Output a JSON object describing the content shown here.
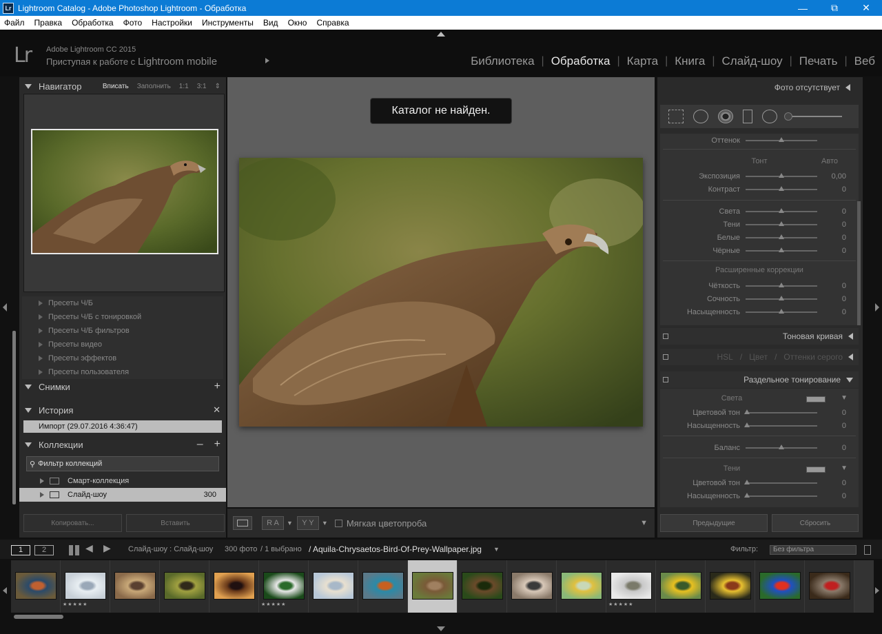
{
  "window": {
    "title": "Lightroom Catalog - Adobe Photoshop Lightroom - Обработка",
    "icon": "Lr"
  },
  "menu": [
    "Файл",
    "Правка",
    "Обработка",
    "Фото",
    "Настройки",
    "Инструменты",
    "Вид",
    "Окно",
    "Справка"
  ],
  "header": {
    "logo": "Lr",
    "app_name": "Adobe Lightroom CC 2015",
    "mobile_prefix": "Приступая к работе с",
    "mobile_brand": "Lightroom mobile"
  },
  "modules": [
    {
      "label": "Библиотека",
      "active": false
    },
    {
      "label": "Обработка",
      "active": true
    },
    {
      "label": "Карта",
      "active": false
    },
    {
      "label": "Книга",
      "active": false
    },
    {
      "label": "Слайд-шоу",
      "active": false
    },
    {
      "label": "Печать",
      "active": false
    },
    {
      "label": "Веб",
      "active": false
    }
  ],
  "navigator": {
    "title": "Навигатор",
    "zoom": [
      "Вписать",
      "Заполнить",
      "1:1",
      "3:1"
    ],
    "zoom_selected": "Вписать"
  },
  "presets": [
    "Пресеты Ч/Б",
    "Пресеты Ч/Б с тонировкой",
    "Пресеты Ч/Б фильтров",
    "Пресеты видео",
    "Пресеты эффектов",
    "Пресеты пользователя"
  ],
  "snapshots": {
    "title": "Снимки"
  },
  "history": {
    "title": "История",
    "item": "Импорт (29.07.2016 4:36:47)"
  },
  "collections": {
    "title": "Коллекции",
    "filter_placeholder": "Фильтр коллекций",
    "items": [
      {
        "label": "Смарт-коллекция",
        "count": ""
      },
      {
        "label": "Слайд-шоу",
        "count": "300"
      }
    ]
  },
  "left_buttons": {
    "copy": "Копировать...",
    "paste": "Вставить"
  },
  "toast": "Каталог не найден.",
  "toolbar": {
    "soft_proof": "Мягкая цветопроба",
    "ra": "R A",
    "yy": "Y Y"
  },
  "right_panel": {
    "no_photo": "Фото отсутствует",
    "basic": {
      "tint_label": "Оттенок",
      "tone_title": "Тонт",
      "auto": "Авто",
      "exposure": {
        "label": "Экспозиция",
        "value": "0,00"
      },
      "contrast": {
        "label": "Контраст",
        "value": "0"
      },
      "highlights": {
        "label": "Света",
        "value": "0"
      },
      "shadows": {
        "label": "Тени",
        "value": "0"
      },
      "whites": {
        "label": "Белые",
        "value": "0"
      },
      "blacks": {
        "label": "Чёрные",
        "value": "0"
      },
      "presence_title": "Расширенные коррекции",
      "clarity": {
        "label": "Чёткость",
        "value": "0"
      },
      "vibrance": {
        "label": "Сочность",
        "value": "0"
      },
      "saturation": {
        "label": "Насыщенность",
        "value": "0"
      }
    },
    "tone_curve": "Тоновая кривая",
    "hsl": [
      "HSL",
      "Цвет",
      "Оттенки серого"
    ],
    "split_toning": {
      "title": "Раздельное тонирование",
      "highlights_title": "Света",
      "hue": {
        "label": "Цветовой тон",
        "value": "0"
      },
      "saturation": {
        "label": "Насыщенность",
        "value": "0"
      },
      "balance": {
        "label": "Баланс",
        "value": "0"
      },
      "shadows_title": "Тени",
      "hue2": {
        "label": "Цветовой тон",
        "value": "0"
      },
      "saturation2": {
        "label": "Насыщенность",
        "value": "0"
      }
    },
    "buttons": {
      "previous": "Предыдущие",
      "reset": "Сбросить"
    }
  },
  "filmstrip_bar": {
    "page1": "1",
    "page2": "2",
    "source": "Слайд-шоу : Слайд-шоу",
    "count": "300 фото",
    "selected": "/ 1 выбрано",
    "filename": "/ Aquila-Chrysaetos-Bird-Of-Prey-Wallpaper.jpg",
    "filter_label": "Фильтр:",
    "filter_value": "Без фильтра"
  },
  "filmstrip": [
    {
      "name": "mandarin-duck",
      "colors": [
        "#6a5a3a",
        "#2a4a6a",
        "#c06030"
      ],
      "stars": ""
    },
    {
      "name": "white-peacock",
      "colors": [
        "#c8d0d8",
        "#e8eef2",
        "#9aa8b8"
      ],
      "stars": "★★★★★"
    },
    {
      "name": "eagle-head",
      "colors": [
        "#8a6a4a",
        "#c8a878",
        "#5a4030"
      ],
      "stars": ""
    },
    {
      "name": "crowned-crane",
      "colors": [
        "#5a6a2a",
        "#a0a040",
        "#302a1a"
      ],
      "stars": ""
    },
    {
      "name": "bird-branch",
      "colors": [
        "#e0a050",
        "#6a3a1a",
        "#201010"
      ],
      "stars": ""
    },
    {
      "name": "swan",
      "colors": [
        "#1a4a1a",
        "#e8e8e8",
        "#2a6a2a"
      ],
      "stars": "★★★★★"
    },
    {
      "name": "pelican",
      "colors": [
        "#b8c8d8",
        "#e8e0d0",
        "#a8b8c8"
      ],
      "stars": ""
    },
    {
      "name": "kingfisher",
      "colors": [
        "#5a7a8a",
        "#2a8aa8",
        "#c86020"
      ],
      "stars": ""
    },
    {
      "name": "eagle-selected",
      "colors": [
        "#6a7a3a",
        "#7a5a38",
        "#a08060"
      ],
      "stars": ""
    },
    {
      "name": "hawk",
      "colors": [
        "#2a4a1a",
        "#6a4a2a",
        "#1a2a0a"
      ],
      "stars": ""
    },
    {
      "name": "stork",
      "colors": [
        "#8a7a6a",
        "#d8c8b8",
        "#3a3a3a"
      ],
      "stars": ""
    },
    {
      "name": "goldfinch",
      "colors": [
        "#8ab878",
        "#e0c040",
        "#c8d8b8"
      ],
      "stars": ""
    },
    {
      "name": "white-peacock-2",
      "colors": [
        "#e8e8e8",
        "#c8c8c8",
        "#7a7a6a"
      ],
      "stars": "★★★★★"
    },
    {
      "name": "yellow-bird",
      "colors": [
        "#6a8a4a",
        "#e8c020",
        "#3a5a2a"
      ],
      "stars": ""
    },
    {
      "name": "colorful-bird",
      "colors": [
        "#2a2a1a",
        "#e8c030",
        "#8a3a1a"
      ],
      "stars": ""
    },
    {
      "name": "lorikeet",
      "colors": [
        "#2a6a2a",
        "#2050c0",
        "#e03020"
      ],
      "stars": ""
    },
    {
      "name": "crane-dark",
      "colors": [
        "#3a2a1a",
        "#8a7a6a",
        "#c02020"
      ],
      "stars": ""
    }
  ]
}
